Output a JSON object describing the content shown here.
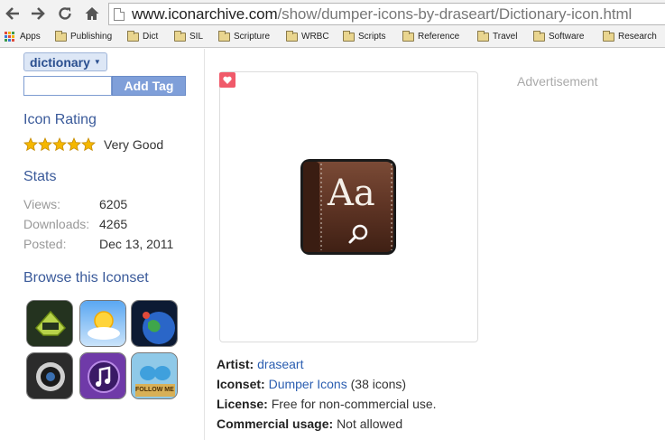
{
  "browser": {
    "url_host": "www.iconarchive.com",
    "url_path": "/show/dumper-icons-by-draseart/Dictionary-icon.html",
    "bookmarks": [
      "Apps",
      "Publishing",
      "Dict",
      "SIL",
      "Scripture",
      "WRBC",
      "Scripts",
      "Reference",
      "Travel",
      "Software",
      "Research"
    ]
  },
  "sidebar": {
    "tag": "dictionary",
    "tag_input_value": "",
    "add_tag_label": "Add Tag",
    "rating_title": "Icon Rating",
    "rating_stars": 5,
    "rating_text": "Very Good",
    "stats_title": "Stats",
    "stats": [
      {
        "label": "Views:",
        "value": "6205"
      },
      {
        "label": "Downloads:",
        "value": "4265"
      },
      {
        "label": "Posted:",
        "value": "Dec 13, 2011"
      }
    ],
    "browse_title": "Browse this Iconset",
    "thumbnails": [
      "deviantart-icon",
      "weather-icon",
      "earth-icon",
      "camera-icon",
      "itunes-icon",
      "twitter-follow-me-icon"
    ],
    "thumbnail_text": "FOLLOW ME"
  },
  "main": {
    "advertisement": "Advertisement",
    "icon_letters": "Aa",
    "artist_label": "Artist:",
    "artist": "draseart",
    "iconset_label": "Iconset:",
    "iconset": "Dumper Icons",
    "iconset_count": "(38 icons)",
    "license_label": "License:",
    "license": "Free for non-commercial use.",
    "commercial_label": "Commercial usage:",
    "commercial": "Not allowed"
  },
  "colors": {
    "link": "#2a5db0",
    "section_title": "#3a5a9a",
    "add_tag_button": "#7f9fd9",
    "favorite": "#f05a6a",
    "star": "#f5b700"
  }
}
